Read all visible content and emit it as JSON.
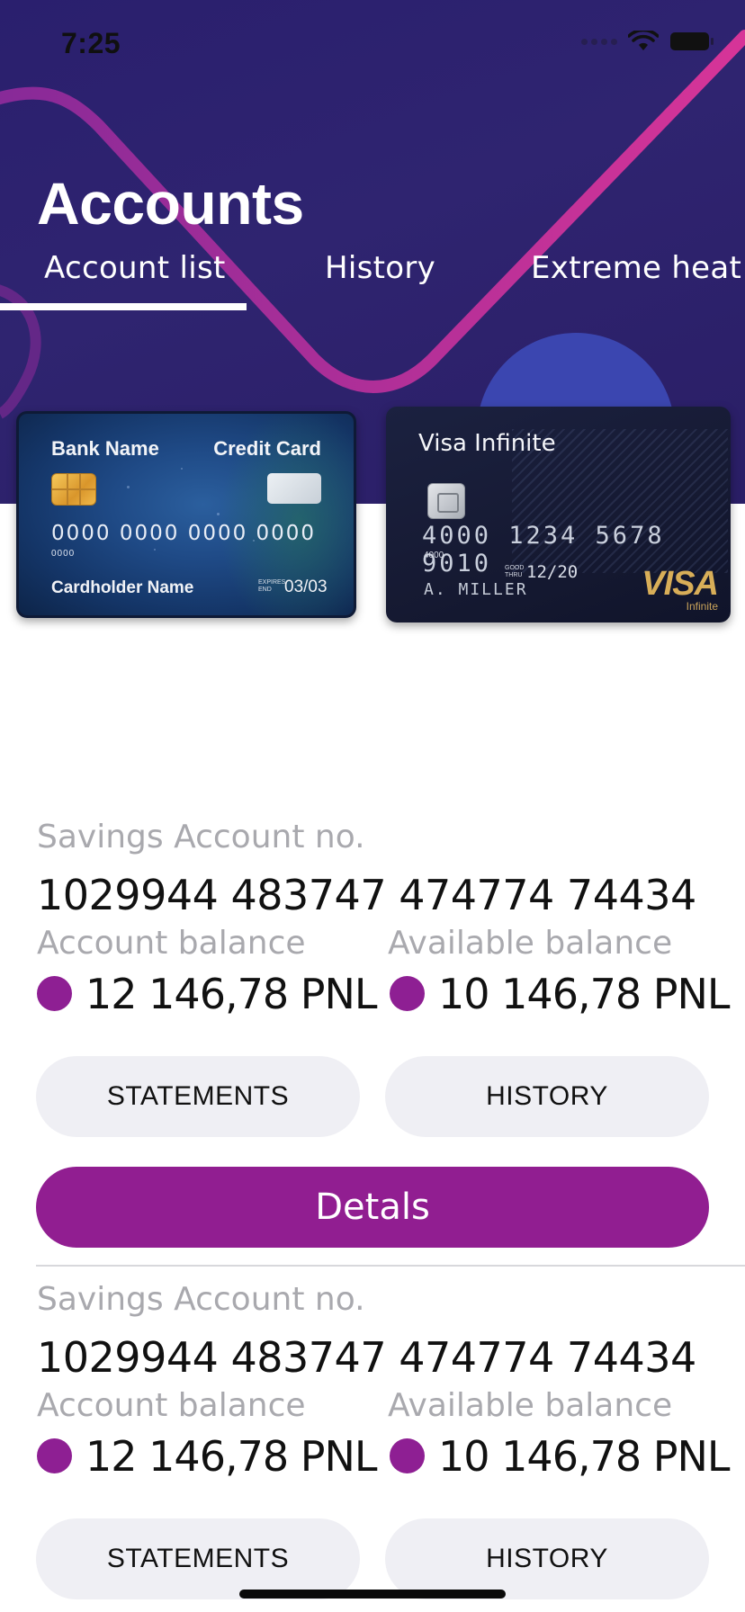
{
  "status_bar": {
    "time": "7:25"
  },
  "header": {
    "title": "Accounts",
    "tabs": [
      {
        "label": "Account list",
        "active": true
      },
      {
        "label": "History",
        "active": false
      },
      {
        "label": "Extreme heat",
        "active": false
      }
    ]
  },
  "cards": [
    {
      "bank_name": "Bank Name",
      "type": "Credit Card",
      "number": "0000 0000 0000 0000",
      "number_short": "0000",
      "holder": "Cardholder Name",
      "expiry_label": "EXPIRES END",
      "expiry": "03/03"
    },
    {
      "name": "Visa Infinite",
      "number": "4000 1234 5678 9010",
      "number_short": "4000",
      "expiry_label": "GOOD THRU",
      "expiry": "12/20",
      "holder": "A. MILLER",
      "brand": "VISA",
      "tier": "Infinite"
    }
  ],
  "accounts": [
    {
      "label": "Savings Account no.",
      "number": "1029944 483747 474774 74434",
      "account_balance_label": "Account balance",
      "account_balance": "12 146,78 PNL",
      "available_balance_label": "Available balance",
      "available_balance": "10 146,78 PNL",
      "statements_label": "STATEMENTS",
      "history_label": "HISTORY",
      "details_label": "Detals"
    },
    {
      "label": "Savings Account no.",
      "number": "1029944 483747 474774 74434",
      "account_balance_label": "Account balance",
      "account_balance": "12 146,78 PNL",
      "available_balance_label": "Available balance",
      "available_balance": "10 146,78 PNL",
      "statements_label": "STATEMENTS",
      "history_label": "HISTORY"
    }
  ],
  "colors": {
    "header_bg": "#2d2270",
    "accent": "#911e91",
    "pill_bg": "#efeff4",
    "muted_text": "#a9a9ae",
    "decor_pink": "#d6329a"
  }
}
